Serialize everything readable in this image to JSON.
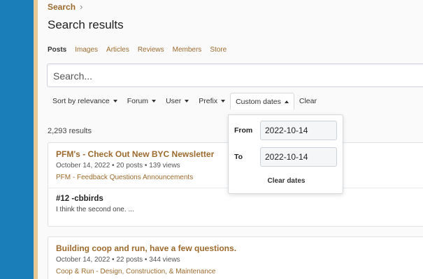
{
  "breadcrumb": {
    "label": "Search"
  },
  "page": {
    "title": "Search results"
  },
  "tabs": [
    {
      "label": "Posts",
      "active": true
    },
    {
      "label": "Images"
    },
    {
      "label": "Articles"
    },
    {
      "label": "Reviews"
    },
    {
      "label": "Members"
    },
    {
      "label": "Store"
    }
  ],
  "search": {
    "placeholder": "Search..."
  },
  "filters": {
    "sort": "Sort by relevance",
    "forum": "Forum",
    "user": "User",
    "prefix": "Prefix",
    "custom_dates": "Custom dates",
    "clear": "Clear"
  },
  "date_dropdown": {
    "from_label": "From",
    "from_value": "2022-10-14",
    "to_label": "To",
    "to_value": "2022-10-14",
    "clear_label": "Clear dates"
  },
  "results_count": "2,293 results",
  "results": [
    {
      "title": "PFM's - Check Out New BYC Newsletter",
      "meta": "October 14, 2022 • 20 posts • 139 views",
      "forum": "PFM - Feedback Questions Announcements",
      "reply_title": "#12 -cbbirds",
      "reply_body": "I think the second one. ..."
    },
    {
      "title": "Building coop and run, have a few questions.",
      "meta": "October 14, 2022 • 22 posts • 344 views",
      "forum": "Coop & Run - Design, Construction, & Maintenance"
    }
  ],
  "colors": {
    "accent": "#9c6a2d",
    "background_blue": "#1a7fb8",
    "strip_gold": "#e8c995"
  }
}
